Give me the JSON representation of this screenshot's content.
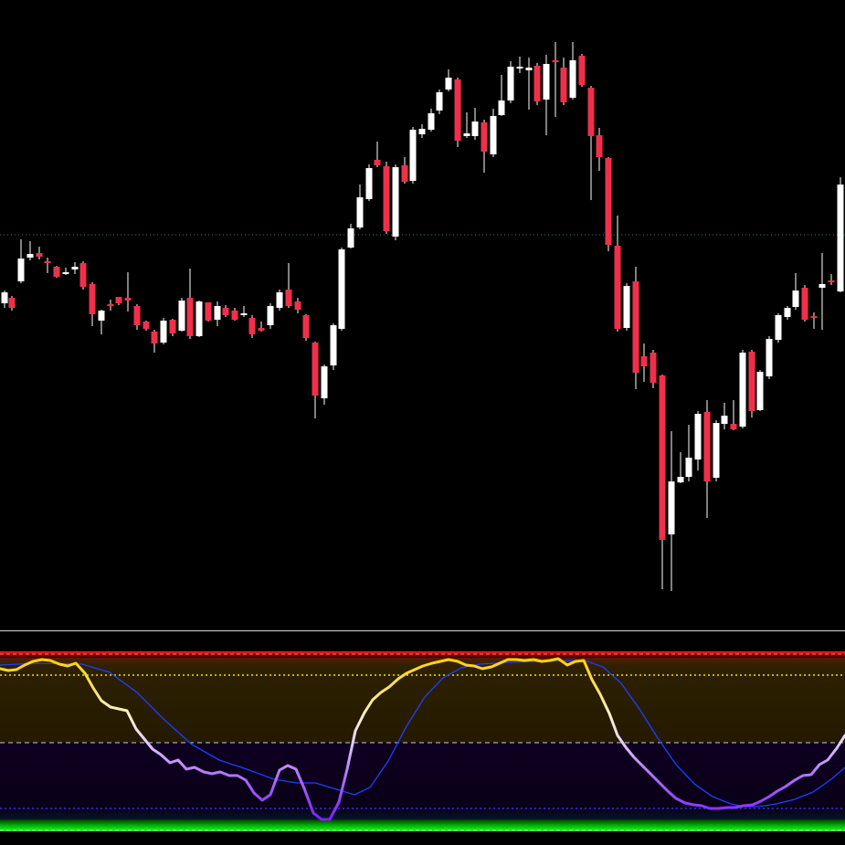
{
  "colors": {
    "background": "#000000",
    "bull_candle": "#ffffff",
    "bear_candle": "#f0304a",
    "wick": "#ffffff",
    "reference_line": "#1f8a70",
    "separator": "#bbbbbb",
    "signal_line": "#1e3fff",
    "overbought_level": "#ffdd00",
    "midline": "#cccccc",
    "oversold_level": "#3030ff",
    "top_band": "#c00000",
    "bottom_band": "#00cc00"
  },
  "chart_data": [
    {
      "type": "candlestick",
      "title": "",
      "reference_line": {
        "style": "dotted"
      },
      "candles": [
        [
          5,
          332,
          320,
          337,
          318
        ],
        [
          13,
          326,
          337,
          340,
          324
        ],
        [
          23,
          308,
          283,
          262,
          310
        ],
        [
          33,
          282,
          278,
          264,
          285
        ],
        [
          43,
          277,
          281,
          270,
          284
        ],
        [
          52,
          286,
          288,
          282,
          299
        ],
        [
          62,
          292,
          303,
          291,
          304
        ],
        [
          72,
          300,
          298,
          293,
          301
        ],
        [
          82,
          295,
          292,
          287,
          300
        ],
        [
          91,
          288,
          314,
          286,
          317
        ],
        [
          101,
          311,
          344,
          309,
          357
        ],
        [
          111,
          351,
          340,
          339,
          366
        ],
        [
          121,
          333,
          334,
          328,
          340
        ],
        [
          130,
          325,
          332,
          325,
          334
        ],
        [
          140,
          326,
          329,
          298,
          341
        ],
        [
          150,
          335,
          356,
          333,
          361
        ],
        [
          160,
          352,
          360,
          351,
          362
        ],
        [
          169,
          363,
          376,
          361,
          386
        ],
        [
          179,
          375,
          351,
          348,
          377
        ],
        [
          189,
          350,
          365,
          349,
          368
        ],
        [
          199,
          362,
          329,
          326,
          363
        ],
        [
          208,
          326,
          368,
          294,
          371
        ],
        [
          218,
          368,
          330,
          329,
          369
        ],
        [
          228,
          331,
          351,
          331,
          352
        ],
        [
          238,
          350,
          335,
          330,
          357
        ],
        [
          247,
          337,
          345,
          334,
          347
        ],
        [
          257,
          340,
          350,
          337,
          351
        ],
        [
          267,
          344,
          343,
          335,
          347
        ],
        [
          276,
          348,
          366,
          345,
          370
        ],
        [
          286,
          359,
          362,
          352,
          363
        ],
        [
          296,
          356,
          335,
          332,
          360
        ],
        [
          306,
          337,
          320,
          317,
          340
        ],
        [
          316,
          317,
          335,
          288,
          337
        ],
        [
          326,
          330,
          339,
          326,
          343
        ],
        [
          335,
          345,
          370,
          344,
          373
        ],
        [
          345,
          375,
          433,
          374,
          458
        ],
        [
          355,
          436,
          401,
          399,
          443
        ],
        [
          365,
          400,
          356,
          354,
          405
        ],
        [
          374,
          360,
          273,
          271,
          362
        ],
        [
          384,
          271,
          250,
          245,
          272
        ],
        [
          394,
          249,
          216,
          202,
          251
        ],
        [
          404,
          218,
          184,
          180,
          220
        ],
        [
          413,
          175,
          181,
          155,
          183
        ],
        [
          423,
          182,
          253,
          177,
          256
        ],
        [
          433,
          259,
          183,
          180,
          263
        ],
        [
          443,
          181,
          199,
          172,
          201
        ],
        [
          452,
          198,
          142,
          139,
          201
        ],
        [
          462,
          147,
          141,
          136,
          151
        ],
        [
          472,
          142,
          124,
          119,
          144
        ],
        [
          481,
          121,
          101,
          98,
          125
        ],
        [
          491,
          98,
          85,
          76,
          100
        ],
        [
          501,
          87,
          154,
          85,
          161
        ],
        [
          511,
          149,
          146,
          123,
          151
        ],
        [
          520,
          149,
          133,
          118,
          153
        ],
        [
          530,
          134,
          166,
          131,
          189
        ],
        [
          540,
          169,
          127,
          119,
          172
        ],
        [
          549,
          126,
          110,
          82,
          127
        ],
        [
          559,
          110,
          73,
          67,
          113
        ],
        [
          569,
          74,
          73,
          62,
          80
        ],
        [
          579,
          77,
          74,
          63,
          120
        ],
        [
          588,
          72,
          111,
          69,
          115
        ],
        [
          598,
          109,
          70,
          60,
          148
        ],
        [
          608,
          66,
          68,
          46,
          128
        ],
        [
          617,
          74,
          112,
          63,
          115
        ],
        [
          627,
          107,
          66,
          46,
          109
        ],
        [
          637,
          61,
          93,
          59,
          95
        ],
        [
          647,
          96,
          149,
          94,
          219
        ],
        [
          656,
          148,
          172,
          140,
          187
        ],
        [
          666,
          173,
          268,
          172,
          275
        ],
        [
          676,
          269,
          360,
          236,
          363
        ],
        [
          686,
          359,
          313,
          310,
          362
        ],
        [
          696,
          308,
          408,
          292,
          426
        ],
        [
          705,
          390,
          401,
          376,
          418
        ],
        [
          715,
          386,
          419,
          383,
          425
        ],
        [
          725,
          411,
          591,
          410,
          645
        ],
        [
          735,
          585,
          527,
          472,
          647
        ],
        [
          745,
          528,
          522,
          495,
          529
        ],
        [
          754,
          522,
          501,
          465,
          527
        ],
        [
          764,
          503,
          453,
          450,
          515
        ],
        [
          774,
          451,
          527,
          438,
          567
        ],
        [
          784,
          523,
          463,
          460,
          527
        ],
        [
          793,
          464,
          455,
          441,
          470
        ],
        [
          803,
          464,
          470,
          438,
          471
        ],
        [
          813,
          467,
          386,
          383,
          469
        ],
        [
          823,
          385,
          450,
          383,
          457
        ],
        [
          832,
          449,
          407,
          405,
          450
        ],
        [
          842,
          412,
          371,
          368,
          415
        ],
        [
          852,
          372,
          345,
          343,
          375
        ],
        [
          862,
          347,
          337,
          335,
          350
        ],
        [
          871,
          336,
          318,
          299,
          339
        ],
        [
          881,
          315,
          350,
          312,
          352
        ],
        [
          891,
          346,
          348,
          342,
          360
        ],
        [
          900,
          315,
          311,
          277,
          361
        ],
        [
          910,
          307,
          307,
          300,
          312
        ],
        [
          920,
          319,
          202,
          194,
          320
        ]
      ]
    },
    {
      "type": "line",
      "title": "",
      "levels": [
        {
          "style": "dotted"
        },
        {
          "style": "dashed"
        },
        {
          "style": "dotted"
        }
      ],
      "series": [
        {
          "role": "oscillator",
          "points": [
            [
              0,
              732
            ],
            [
              9,
              734
            ],
            [
              18,
              733
            ],
            [
              27,
              728
            ],
            [
              36,
              724
            ],
            [
              46,
              722
            ],
            [
              55,
              723
            ],
            [
              65,
              727
            ],
            [
              74,
              729
            ],
            [
              83,
              726
            ],
            [
              93,
              737
            ],
            [
              102,
              753
            ],
            [
              111,
              767
            ],
            [
              121,
              774
            ],
            [
              130,
              776
            ],
            [
              139,
              778
            ],
            [
              149,
              798
            ],
            [
              158,
              809
            ],
            [
              167,
              820
            ],
            [
              176,
              826
            ],
            [
              186,
              835
            ],
            [
              195,
              832
            ],
            [
              204,
              842
            ],
            [
              213,
              840
            ],
            [
              223,
              845
            ],
            [
              232,
              847
            ],
            [
              241,
              845
            ],
            [
              251,
              849
            ],
            [
              260,
              849
            ],
            [
              269,
              854
            ],
            [
              278,
              868
            ],
            [
              287,
              876
            ],
            [
              296,
              870
            ],
            [
              306,
              843
            ],
            [
              315,
              838
            ],
            [
              324,
              842
            ],
            [
              333,
              863
            ],
            [
              343,
              890
            ],
            [
              352,
              897
            ],
            [
              361,
              897
            ],
            [
              371,
              878
            ],
            [
              380,
              842
            ],
            [
              389,
              800
            ],
            [
              399,
              780
            ],
            [
              408,
              766
            ],
            [
              417,
              758
            ],
            [
              426,
              752
            ],
            [
              436,
              743
            ],
            [
              445,
              737
            ],
            [
              454,
              733
            ],
            [
              463,
              729
            ],
            [
              473,
              726
            ],
            [
              482,
              724
            ],
            [
              491,
              722
            ],
            [
              501,
              724
            ],
            [
              510,
              728
            ],
            [
              519,
              729
            ],
            [
              528,
              732
            ],
            [
              538,
              730
            ],
            [
              547,
              726
            ],
            [
              556,
              722
            ],
            [
              565,
              722
            ],
            [
              574,
              723
            ],
            [
              584,
              722
            ],
            [
              593,
              724
            ],
            [
              602,
              723
            ],
            [
              611,
              721
            ],
            [
              621,
              728
            ],
            [
              630,
              724
            ],
            [
              639,
              723
            ],
            [
              648,
              744
            ],
            [
              657,
              760
            ],
            [
              667,
              781
            ],
            [
              676,
              805
            ],
            [
              685,
              818
            ],
            [
              694,
              829
            ],
            [
              703,
              838
            ],
            [
              713,
              848
            ],
            [
              722,
              857
            ],
            [
              731,
              866
            ],
            [
              740,
              874
            ],
            [
              750,
              879
            ],
            [
              759,
              881
            ],
            [
              768,
              882
            ],
            [
              777,
              885
            ],
            [
              787,
              885
            ],
            [
              796,
              884
            ],
            [
              805,
              884
            ],
            [
              814,
              882
            ],
            [
              824,
              881
            ],
            [
              833,
              877
            ],
            [
              842,
              872
            ],
            [
              851,
              866
            ],
            [
              860,
              861
            ],
            [
              870,
              854
            ],
            [
              879,
              849
            ],
            [
              888,
              848
            ],
            [
              897,
              837
            ],
            [
              906,
              832
            ],
            [
              916,
              819
            ],
            [
              925,
              805
            ]
          ]
        },
        {
          "role": "signal",
          "points": [
            [
              0,
              728
            ],
            [
              40,
              726
            ],
            [
              90,
              727
            ],
            [
              120,
              736
            ],
            [
              150,
              758
            ],
            [
              180,
              788
            ],
            [
              210,
              815
            ],
            [
              240,
              832
            ],
            [
              270,
              842
            ],
            [
              300,
              853
            ],
            [
              325,
              857
            ],
            [
              345,
              857
            ],
            [
              365,
              863
            ],
            [
              388,
              870
            ],
            [
              405,
              862
            ],
            [
              425,
              833
            ],
            [
              445,
              795
            ],
            [
              465,
              763
            ],
            [
              485,
              742
            ],
            [
              505,
              731
            ],
            [
              525,
              727
            ],
            [
              560,
              725
            ],
            [
              600,
              724
            ],
            [
              640,
              723
            ],
            [
              660,
              730
            ],
            [
              680,
              748
            ],
            [
              700,
              776
            ],
            [
              720,
              808
            ],
            [
              740,
              837
            ],
            [
              760,
              858
            ],
            [
              780,
              872
            ],
            [
              800,
              880
            ],
            [
              815,
              883
            ],
            [
              830,
              883
            ],
            [
              850,
              880
            ],
            [
              870,
              875
            ],
            [
              890,
              867
            ],
            [
              910,
              853
            ],
            [
              925,
              840
            ]
          ]
        }
      ]
    }
  ]
}
